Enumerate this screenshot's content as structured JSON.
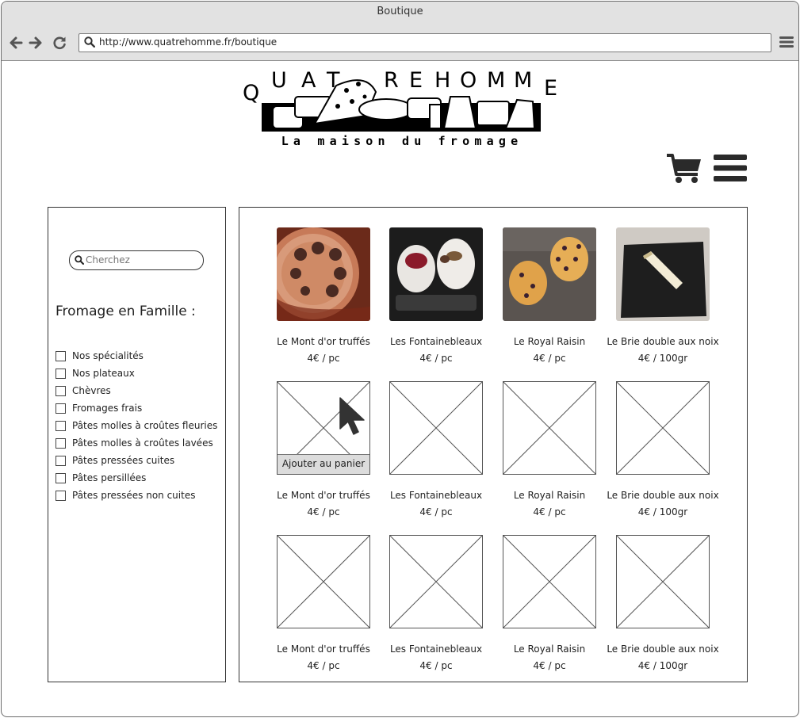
{
  "window": {
    "title": "Boutique"
  },
  "browser": {
    "url": "http://www.quatrehomme.fr/boutique"
  },
  "logo": {
    "brand": "QUATREHOMME",
    "tagline": "La maison du fromage"
  },
  "search": {
    "placeholder": "Cherchez"
  },
  "sidebar": {
    "title": "Fromage en Famille :",
    "filters": [
      "Nos spécialités",
      "Nos plateaux",
      "Chèvres",
      "Fromages frais",
      "Pâtes molles à croûtes fleuries",
      "Pâtes molles à croûtes lavées",
      "Pâtes pressées cuites",
      "Pâtes persillées",
      "Pâtes pressées non cuites"
    ]
  },
  "products": [
    {
      "name": "Le Mont d'or truffés",
      "price": "4€ / pc",
      "image": "photo-truffles"
    },
    {
      "name": "Les Fontainebleaux",
      "price": "4€ / pc",
      "image": "photo-fontainebleau"
    },
    {
      "name": "Le Royal Raisin",
      "price": "4€ / pc",
      "image": "photo-raisin"
    },
    {
      "name": "Le Brie double aux noix",
      "price": "4€ / 100gr",
      "image": "photo-brie"
    },
    {
      "name": "Le Mont d'or truffés",
      "price": "4€ / pc",
      "image": "placeholder",
      "hover_action": "Ajouter au panier"
    },
    {
      "name": "Les Fontainebleaux",
      "price": "4€ / pc",
      "image": "placeholder"
    },
    {
      "name": "Le Royal Raisin",
      "price": "4€ / pc",
      "image": "placeholder"
    },
    {
      "name": "Le Brie double aux noix",
      "price": "4€ / 100gr",
      "image": "placeholder"
    },
    {
      "name": "Le Mont d'or truffés",
      "price": "4€ / pc",
      "image": "placeholder"
    },
    {
      "name": "Les Fontainebleaux",
      "price": "4€ / pc",
      "image": "placeholder"
    },
    {
      "name": "Le Royal Raisin",
      "price": "4€ / pc",
      "image": "placeholder"
    },
    {
      "name": "Le Brie double aux noix",
      "price": "4€ / 100gr",
      "image": "placeholder"
    }
  ],
  "icons": {
    "back": "arrow-left-icon",
    "forward": "arrow-right-icon",
    "reload": "reload-icon",
    "url_search": "search-icon",
    "browser_menu": "menu-icon",
    "cart": "cart-icon",
    "site_menu": "hamburger-icon"
  }
}
